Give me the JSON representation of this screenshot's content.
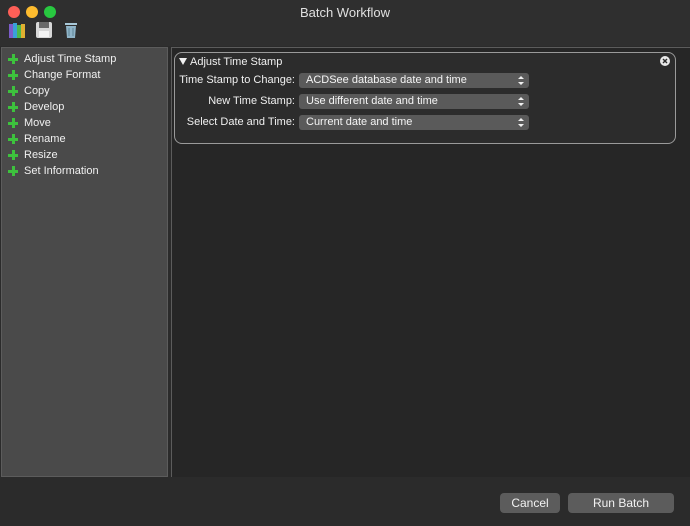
{
  "window": {
    "title": "Batch Workflow"
  },
  "toolbar": {
    "icons": [
      "books-icon",
      "save-icon",
      "trash-icon"
    ]
  },
  "sidebar": {
    "items": [
      {
        "label": "Adjust Time Stamp"
      },
      {
        "label": "Change Format"
      },
      {
        "label": "Copy"
      },
      {
        "label": "Develop"
      },
      {
        "label": "Move"
      },
      {
        "label": "Rename"
      },
      {
        "label": "Resize"
      },
      {
        "label": "Set Information"
      }
    ]
  },
  "panel": {
    "title": "Adjust Time Stamp",
    "rows": [
      {
        "label": "Time Stamp to Change:",
        "value": "ACDSee database date and time"
      },
      {
        "label": "New Time Stamp:",
        "value": "Use different date and time"
      },
      {
        "label": "Select Date and Time:",
        "value": "Current date and time"
      }
    ]
  },
  "footer": {
    "cancel_label": "Cancel",
    "run_label": "Run Batch"
  },
  "colors": {
    "accent_plus": "#3dc23d",
    "background": "#2b2b2b",
    "sidebar": "#4a4a4a"
  }
}
